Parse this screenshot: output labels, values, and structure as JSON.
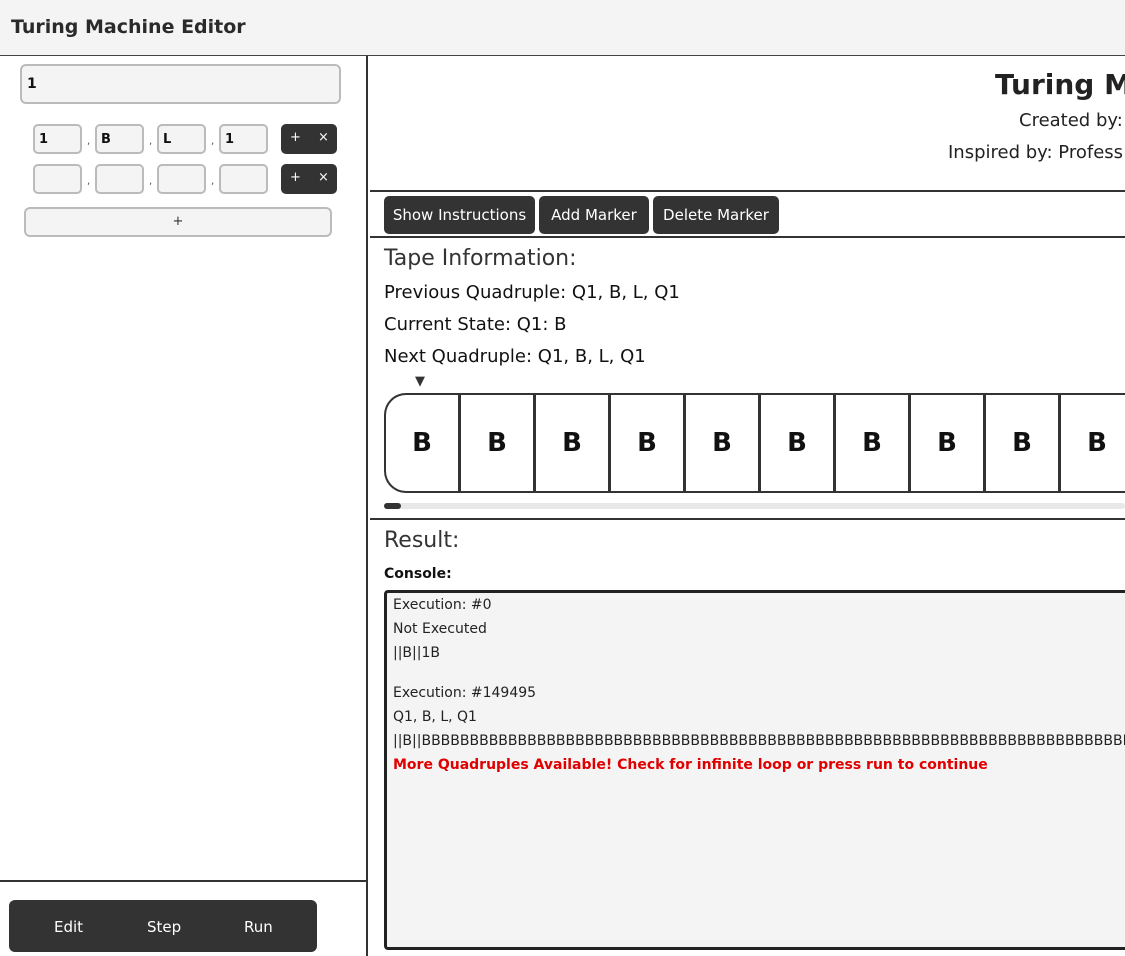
{
  "app": {
    "title": "Turing Machine Editor"
  },
  "editor": {
    "initial_tape": "1",
    "quadruples": [
      {
        "state": "1",
        "read": "B",
        "action": "L",
        "next": "1"
      },
      {
        "state": "",
        "read": "",
        "action": "",
        "next": ""
      }
    ],
    "comma": ",",
    "row_add_label": "+",
    "row_delete_label": "×",
    "add_quadruple_label": "+"
  },
  "controls": {
    "edit": "Edit",
    "step": "Step",
    "run": "Run"
  },
  "header": {
    "title": "Turing Ma",
    "created_by": "Created by:",
    "inspired_by": "Inspired by: Profess"
  },
  "toolbar": {
    "show_instructions": "Show Instructions",
    "add_marker": "Add Marker",
    "delete_marker": "Delete Marker"
  },
  "tape_info": {
    "heading": "Tape Information:",
    "previous": "Previous Quadruple: Q1, B, L, Q1",
    "current": "Current State: Q1: B",
    "next": "Next Quadruple: Q1, B, L, Q1",
    "head_marker": "▼",
    "cells": [
      "B",
      "B",
      "B",
      "B",
      "B",
      "B",
      "B",
      "B",
      "B",
      "B"
    ]
  },
  "result": {
    "heading": "Result:",
    "console_label": "Console:",
    "lines": [
      "Execution: #0",
      "Not Executed",
      "||B||1B",
      "Execution: #149495",
      "Q1, B, L, Q1",
      "||B||BBBBBBBBBBBBBBBBBBBBBBBBBBBBBBBBBBBBBBBBBBBBBBBBBBBBBBBBBBBBBBBBBBBBBBBBBBBBBBBBBBBB",
      "More Quadruples Available! Check for infinite loop or press run to continue"
    ]
  }
}
